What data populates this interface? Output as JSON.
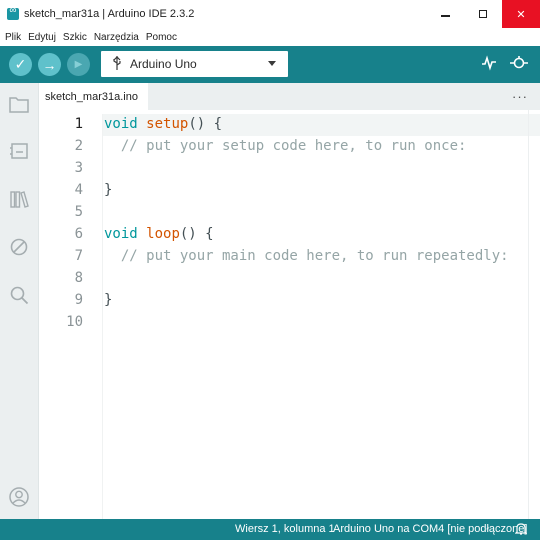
{
  "window": {
    "title": "sketch_mar31a | Arduino IDE 2.3.2",
    "app_icon": "arduino-logo-icon",
    "controls": {
      "minimize": "minimize-icon",
      "maximize": "maximize-icon",
      "close": "✕"
    }
  },
  "menu": [
    "Plik",
    "Edytuj",
    "Szkic",
    "Narzędzia",
    "Pomoc"
  ],
  "toolbar": {
    "verify_glyph": "✓",
    "upload_glyph": "→",
    "debug_glyph": "▶",
    "board_icon": "usb-icon",
    "board_selected": "Arduino Uno",
    "serial_plotter_glyph": "∿",
    "serial_monitor_glyph": "⊙"
  },
  "sidebar": [
    "sketchbook-icon",
    "boards-manager-icon",
    "library-manager-icon",
    "debug-icon",
    "search-icon",
    "account-icon"
  ],
  "editor": {
    "tab_name": "sketch_mar31a.ino",
    "tab_more": "···",
    "active_line": 1,
    "lines": [
      {
        "num": "1",
        "tokens": [
          {
            "t": "void ",
            "c": "kw"
          },
          {
            "t": "setup",
            "c": "fn"
          },
          {
            "t": "() {",
            "c": "pn"
          }
        ]
      },
      {
        "num": "2",
        "tokens": [
          {
            "t": "  // put your setup code here, to run once:",
            "c": "cm"
          }
        ]
      },
      {
        "num": "3",
        "tokens": []
      },
      {
        "num": "4",
        "tokens": [
          {
            "t": "}",
            "c": "pn"
          }
        ]
      },
      {
        "num": "5",
        "tokens": []
      },
      {
        "num": "6",
        "tokens": [
          {
            "t": "void ",
            "c": "kw"
          },
          {
            "t": "loop",
            "c": "fn"
          },
          {
            "t": "() {",
            "c": "pn"
          }
        ]
      },
      {
        "num": "7",
        "tokens": [
          {
            "t": "  // put your main code here, to run repeatedly:",
            "c": "cm"
          }
        ]
      },
      {
        "num": "8",
        "tokens": []
      },
      {
        "num": "9",
        "tokens": [
          {
            "t": "}",
            "c": "pn"
          }
        ]
      },
      {
        "num": "10",
        "tokens": []
      }
    ]
  },
  "status": {
    "cursor": "Wiersz 1, kolumna 1",
    "board": "Arduino Uno na COM4 [nie podłączone]",
    "notifications_icon": "bell-icon"
  },
  "colors": {
    "accent": "#17818b",
    "button": "#5fc1cb",
    "keyword": "#00979c",
    "function": "#d35400",
    "comment": "#95a5a6"
  }
}
